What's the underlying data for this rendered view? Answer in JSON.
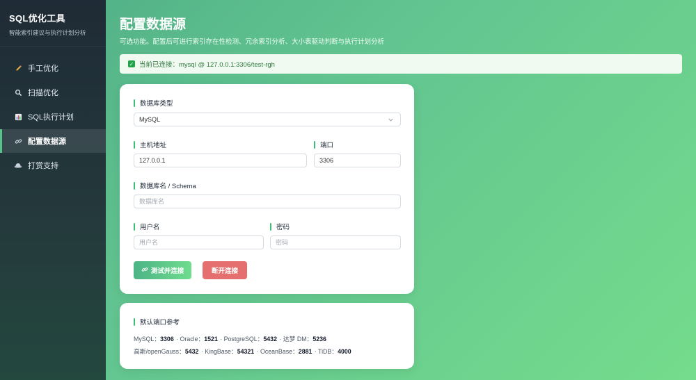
{
  "sidebar": {
    "title": "SQL优化工具",
    "subtitle": "智能索引建议与执行计划分析",
    "items": [
      {
        "label": "手工优化",
        "icon": "pencil-icon"
      },
      {
        "label": "扫描优化",
        "icon": "magnifier-icon"
      },
      {
        "label": "SQL执行计划",
        "icon": "bar-chart-icon"
      },
      {
        "label": "配置数据源",
        "icon": "link-icon",
        "active": true
      },
      {
        "label": "打赏支持",
        "icon": "cap-icon"
      }
    ]
  },
  "main": {
    "title": "配置数据源",
    "description": "可选功能。配置后可进行索引存在性检测、冗余索引分析、大小表驱动判断与执行计划分析",
    "status": "当前已连接：mysql @ 127.0.0.1:3306/test-rgh"
  },
  "form": {
    "db_type_label": "数据库类型",
    "db_type_value": "MySQL",
    "host_label": "主机地址",
    "host_value": "127.0.0.1",
    "port_label": "端口",
    "port_value": "3306",
    "dbname_label": "数据库名 / Schema",
    "dbname_placeholder": "数据库名",
    "user_label": "用户名",
    "user_placeholder": "用户名",
    "password_label": "密码",
    "password_placeholder": "密码",
    "test_button": "测试并连接",
    "disconnect_button": "断开连接"
  },
  "reference": {
    "title": "默认端口参考",
    "line1": [
      {
        "name": "MySQL：",
        "port": "3306",
        "sep": " · "
      },
      {
        "name": "Oracle：",
        "port": "1521",
        "sep": " · "
      },
      {
        "name": "PostgreSQL：",
        "port": "5432",
        "sep": " · "
      },
      {
        "name": "达梦 DM：",
        "port": "5236",
        "sep": ""
      }
    ],
    "line2": [
      {
        "name": "高斯/openGauss：",
        "port": "5432",
        "sep": " · "
      },
      {
        "name": "KingBase：",
        "port": "54321",
        "sep": " · "
      },
      {
        "name": "OceanBase：",
        "port": "2881",
        "sep": " · "
      },
      {
        "name": "TiDB：",
        "port": "4000",
        "sep": ""
      }
    ]
  },
  "colors": {
    "accent": "#3dbd74",
    "danger": "#e56f6f",
    "sidebar_bg": "#1f2b36",
    "status_bg": "#f0faf1",
    "status_text": "#2f7a3c"
  }
}
